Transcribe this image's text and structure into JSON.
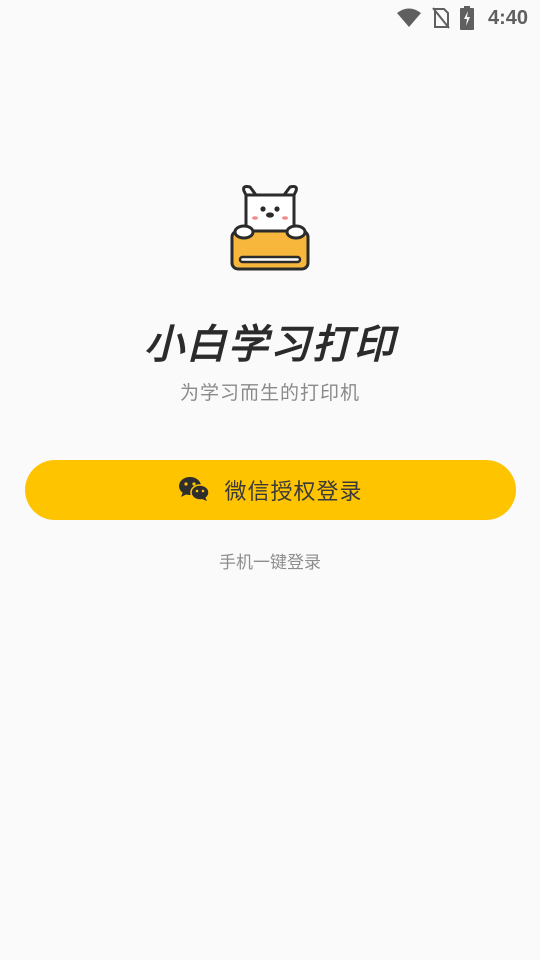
{
  "status_bar": {
    "time": "4:40",
    "icons": [
      "wifi-icon",
      "no-sim-icon",
      "battery-charging-icon"
    ]
  },
  "app": {
    "logo_icon": "dog-printer-logo-icon",
    "title": "小白学习打印",
    "subtitle": "为学习而生的打印机"
  },
  "login": {
    "wechat_icon": "wechat-icon",
    "wechat_label": "微信授权登录",
    "phone_label": "手机一键登录"
  },
  "colors": {
    "accent": "#ffc400",
    "background": "#fafafa",
    "title": "#2b2b2b",
    "muted": "#8a8a8a"
  }
}
